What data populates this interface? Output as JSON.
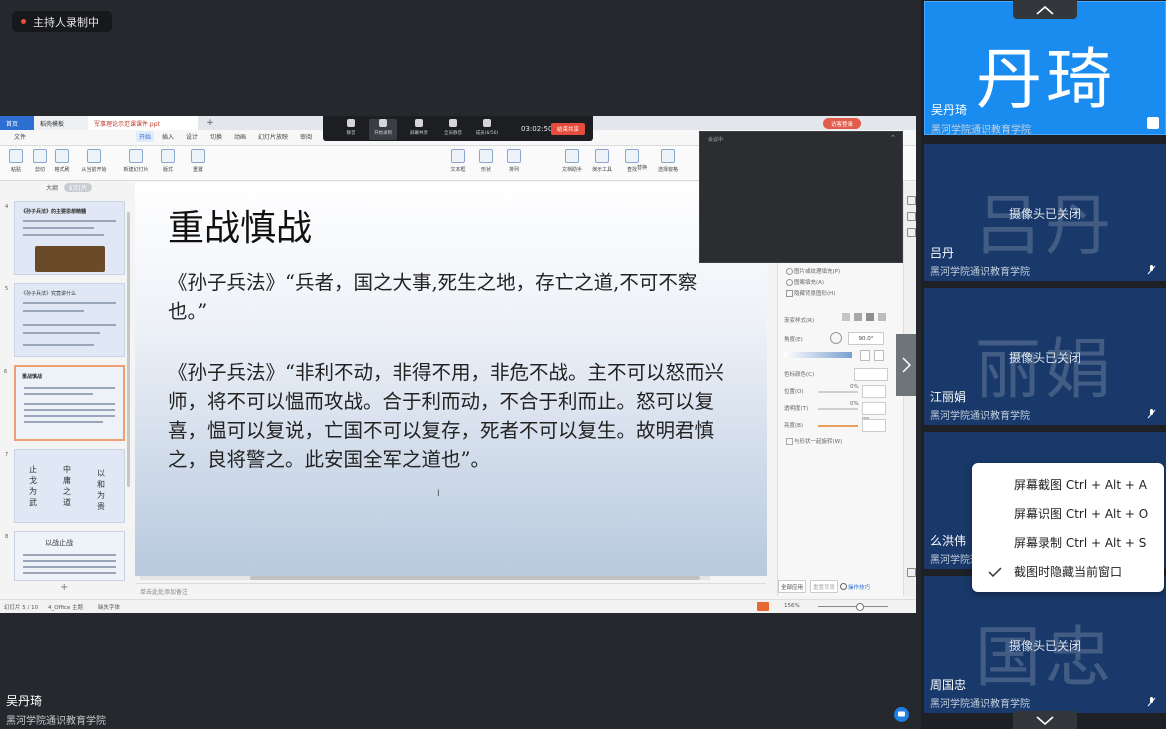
{
  "recording": {
    "label": "主持人录制中"
  },
  "presenter": {
    "name": "吴丹琦",
    "org": "黑河学院通识教育学院"
  },
  "wps": {
    "tabs": {
      "home": "首页",
      "templates": "稻壳模板",
      "doc": "军事理论示范课课件.ppt",
      "add": "+"
    },
    "menu": [
      "文件",
      "开始",
      "插入",
      "设计",
      "切换",
      "动画",
      "幻灯片放映",
      "审阅"
    ],
    "ribbon": [
      "粘贴",
      "剪切",
      "格式刷",
      "从当前开始",
      "新建幻灯片",
      "版式",
      "重置",
      "文本框",
      "形状",
      "排列",
      "文档助手",
      "演示工具",
      "查找",
      "替换",
      "选择窗格"
    ],
    "pane_tabs": {
      "outline": "大纲",
      "slides": "幻灯片"
    },
    "thumbs": [
      {
        "num": "4",
        "title": "《孙子兵法》的主要思想精髓"
      },
      {
        "num": "5",
        "title": "《孙子兵法》究竟讲什么"
      },
      {
        "num": "6",
        "title": "重战慎战"
      },
      {
        "num": "7",
        "title": "止戈为武"
      },
      {
        "num": "8",
        "title": "以战止战"
      }
    ],
    "thumb7": {
      "c1": "止戈为武",
      "c2": "中庸之道",
      "c3": "以和为贵"
    },
    "add_slide": "+",
    "notes_placeholder": "单击此处添加备注",
    "slide": {
      "title": "重战慎战",
      "para1": "《孙子兵法》“兵者，国之大事,死生之地，存亡之道,不可不察也。”",
      "para2": "《孙子兵法》“非利不动，非得不用，非危不战。主不可以怒而兴师，将不可以愠而攻战。合于利而动，不合于利而止。怒可以复喜，愠可以复说，亡国不可以复存，死者不可以复生。故明君慎之，良将警之。此安国全军之道也”。",
      "cursor": "I"
    },
    "taskpane": {
      "opt1": "图片或纹理填充(P)",
      "opt2": "图案填充(A)",
      "opt3": "隐藏背景图形(H)",
      "gradient": "渐变样式(R)",
      "angle_label": "角度(E)",
      "angle_value": "90.0°",
      "color_label": "色标颜色(C)",
      "pos_label": "位置(O)",
      "pos_value": "0%",
      "transp_label": "透明度(T)",
      "transp_value": "0%",
      "bright_label": "亮度(B)",
      "bright_value": "0%",
      "chk_label": "与形状一起旋转(W)",
      "apply_all": "全部应用",
      "reset_bg": "重置背景",
      "ops": "操作技巧"
    },
    "status": {
      "slide_count": "幻灯片 5 / 10",
      "theme": "4_Office 主题",
      "font_missing": "缺失字体",
      "zoom": "156%"
    },
    "login": "访客登录"
  },
  "meeting_bar": {
    "buttons": [
      "静音",
      "开始录制",
      "屏幕共享",
      "全员静音",
      "成员(6/50)"
    ],
    "time": "03:02:50",
    "end": "结束共享"
  },
  "float_window": {
    "title": "会议中"
  },
  "participants": [
    {
      "big": "丹琦",
      "name": "吴丹琦",
      "org": "黑河学院通识教育学院",
      "cam_off": ""
    },
    {
      "big": "吕丹",
      "name": "吕丹",
      "org": "黑河学院通识教育学院",
      "cam_off": "摄像头已关闭"
    },
    {
      "big": "丽娟",
      "name": "江丽娟",
      "org": "黑河学院通识教育学院",
      "cam_off": "摄像头已关闭"
    },
    {
      "big": "",
      "name": "么洪伟",
      "org": "黑河学院通识教育学院",
      "cam_off": ""
    },
    {
      "big": "国忠",
      "name": "周国忠",
      "org": "黑河学院通识教育学院",
      "cam_off": "摄像头已关闭"
    }
  ],
  "context_menu": [
    "屏幕截图 Ctrl + Alt + A",
    "屏幕识图 Ctrl + Alt + O",
    "屏幕录制 Ctrl + Alt + S",
    "截图时隐藏当前窗口"
  ],
  "colors": {
    "accent": "#1a8cf0",
    "tile_bg": "#19396a",
    "end_red": "#e54c3b"
  }
}
